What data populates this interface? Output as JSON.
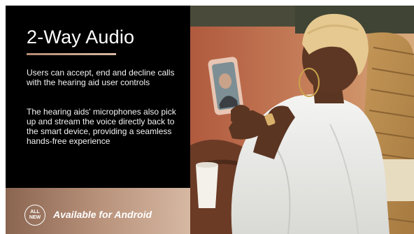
{
  "slide": {
    "title": "2-Way Audio",
    "paragraphs": [
      "Users can accept, end and decline calls with the hearing aid user controls",
      "The hearing aids' microphones also pick up and stream the voice directly back to the smart device, providing a seamless hands-free experience"
    ],
    "badge": {
      "line1": "ALL",
      "line2": "NEW"
    },
    "banner_text": "Available for Android"
  },
  "colors": {
    "background": "#000000",
    "accent_rule": "#c49c84",
    "banner_start": "#8a6550",
    "banner_end": "#d6b8a3"
  }
}
